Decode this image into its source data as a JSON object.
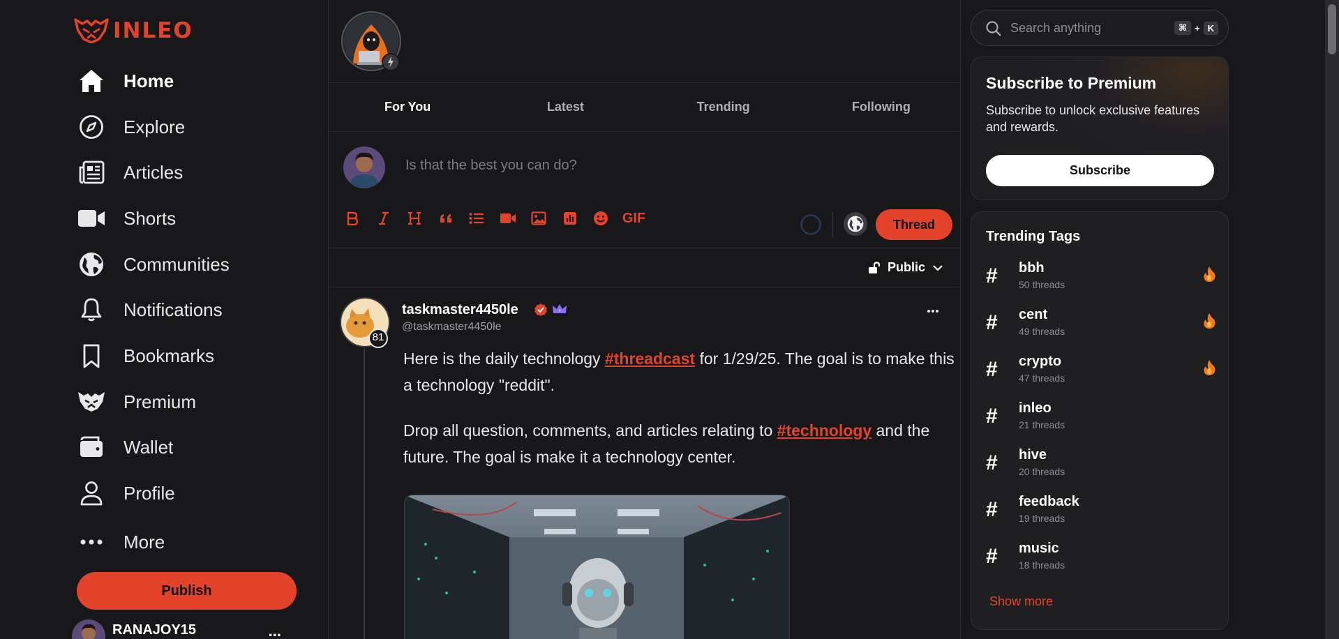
{
  "brand": {
    "logo_text": "INLEO",
    "accent_color": "#e3432b"
  },
  "sidebar": {
    "items": [
      {
        "label": "Home",
        "icon": "home-icon",
        "active": true
      },
      {
        "label": "Explore",
        "icon": "compass-icon"
      },
      {
        "label": "Articles",
        "icon": "newspaper-icon"
      },
      {
        "label": "Shorts",
        "icon": "video-camera-icon"
      },
      {
        "label": "Communities",
        "icon": "globe-icon"
      },
      {
        "label": "Notifications",
        "icon": "bell-icon"
      },
      {
        "label": "Bookmarks",
        "icon": "bookmark-icon"
      },
      {
        "label": "Premium",
        "icon": "leo-premium-icon"
      },
      {
        "label": "Wallet",
        "icon": "wallet-icon"
      },
      {
        "label": "Profile",
        "icon": "user-icon"
      },
      {
        "label": "More",
        "icon": "ellipsis-icon"
      }
    ],
    "publish_label": "Publish",
    "current_user": {
      "name": "RANAJOY15",
      "more": "..."
    }
  },
  "feed": {
    "tabs": [
      {
        "label": "For You",
        "active": true
      },
      {
        "label": "Latest"
      },
      {
        "label": "Trending"
      },
      {
        "label": "Following"
      }
    ],
    "composer": {
      "placeholder": "Is that the best you can do?",
      "tools": [
        "bold-icon",
        "italic-icon",
        "heading-icon",
        "quote-icon",
        "list-icon",
        "video-icon",
        "image-icon",
        "poll-icon",
        "emoji-icon"
      ],
      "gif_label": "GIF",
      "submit_label": "Thread"
    },
    "visibility": {
      "label": "Public"
    },
    "post": {
      "username": "taskmaster4450le",
      "handle": "@taskmaster4450le",
      "reputation": "81",
      "paragraph1": {
        "pre": "Here is the daily technology ",
        "tag": "#threadcast",
        "post": " for 1/29/25. The goal is to make this a technology \"reddit\"."
      },
      "paragraph2": {
        "pre": "Drop all question, comments, and articles relating to ",
        "tag": "#technology",
        "post": " and the future. The goal is make it a technology center."
      }
    }
  },
  "right_panel": {
    "search": {
      "placeholder": "Search anything",
      "shortcut_mod": "⌘",
      "shortcut_plus": "+",
      "shortcut_key": "K"
    },
    "premium": {
      "title": "Subscribe to Premium",
      "description": "Subscribe to unlock exclusive features and rewards.",
      "button_label": "Subscribe"
    },
    "trending": {
      "title": "Trending Tags",
      "hash_symbol": "#",
      "tags": [
        {
          "name": "bbh",
          "count": "50 threads",
          "hot": true
        },
        {
          "name": "cent",
          "count": "49 threads",
          "hot": true
        },
        {
          "name": "crypto",
          "count": "47 threads",
          "hot": true
        },
        {
          "name": "inleo",
          "count": "21 threads",
          "hot": false
        },
        {
          "name": "hive",
          "count": "20 threads",
          "hot": false
        },
        {
          "name": "feedback",
          "count": "19 threads",
          "hot": false
        },
        {
          "name": "music",
          "count": "18 threads",
          "hot": false
        }
      ],
      "show_more_label": "Show more"
    }
  }
}
